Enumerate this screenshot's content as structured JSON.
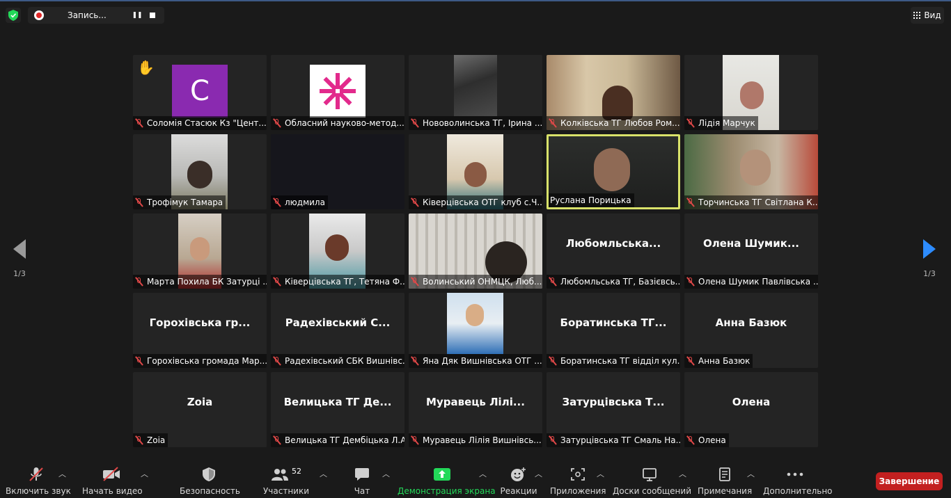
{
  "recording": {
    "label": "Запись..."
  },
  "view": {
    "label": "Вид"
  },
  "pager": {
    "left": "1/3",
    "right": "1/3"
  },
  "tiles": [
    {
      "name": "Соломія Стасюк Кз \"Цент...",
      "avatar_letter": "С",
      "kind": "avatar",
      "hand_raised": true
    },
    {
      "name": "Обласний науково-метод...",
      "kind": "logo"
    },
    {
      "name": "Нововолинська ТГ, Ірина ...",
      "kind": "video"
    },
    {
      "name": "Колківська ТГ Любов Ром...",
      "kind": "video"
    },
    {
      "name": "Лідія Марчук",
      "kind": "video"
    },
    {
      "name": "Трофімук Тамара",
      "kind": "video"
    },
    {
      "name": "людмила",
      "kind": "blank"
    },
    {
      "name": "Ківерцівська ОТГ клуб с.Ч...",
      "kind": "video"
    },
    {
      "name": "Руслана Порицька",
      "kind": "video",
      "active_speaker": true
    },
    {
      "name": "Торчинська ТГ Світлана К...",
      "kind": "video"
    },
    {
      "name": "Марта Похила БК Затурці ...",
      "kind": "video"
    },
    {
      "name": "Ківерцівська ТГ, Тетяна Ф...",
      "kind": "video"
    },
    {
      "name": "Волинський ОНМЦК, Люб...",
      "kind": "video"
    },
    {
      "name": "Любомльська ТГ, Базієвсь...",
      "big": "Любомльська...",
      "kind": "name"
    },
    {
      "name": "Олена Шумик Павлівська ...",
      "big": "Олена  Шумик...",
      "kind": "name"
    },
    {
      "name": "Горохівська громада Мар...",
      "big": "Горохівська  гр...",
      "kind": "name"
    },
    {
      "name": "Радехівський СБК Вишнівс...",
      "big": "Радехівський  С...",
      "kind": "name"
    },
    {
      "name": "Яна Дяк Вишнівська ОТГ ...",
      "kind": "video"
    },
    {
      "name": "Боратинська ТГ відділ кул...",
      "big": "Боратинська  ТГ...",
      "kind": "name"
    },
    {
      "name": "Анна Базюк",
      "big": "Анна Базюк",
      "kind": "name"
    },
    {
      "name": "Zoia",
      "big": "Zoia",
      "kind": "name"
    },
    {
      "name": "Велицька ТГ Дембіцька Л.А.",
      "big": "Велицька  ТГ  Де...",
      "kind": "name"
    },
    {
      "name": "Муравець Лілія Вишнівсь...",
      "big": "Муравець  Лілі...",
      "kind": "name"
    },
    {
      "name": "Затурцівська ТГ Смаль На...",
      "big": "Затурцівська  Т...",
      "kind": "name"
    },
    {
      "name": "Олена",
      "big": "Олена",
      "kind": "name"
    }
  ],
  "toolbar": {
    "unmute": "Включить звук",
    "start_video": "Начать видео",
    "security": "Безопасность",
    "participants": "Участники",
    "participants_count": "52",
    "chat": "Чат",
    "share": "Демонстрация экрана",
    "reactions": "Реакции",
    "apps": "Приложения",
    "whiteboards": "Доски сообщений",
    "notes": "Примечания",
    "more": "Дополнительно",
    "end": "Завершение"
  },
  "colors": {
    "share_green": "#23d959",
    "end_red": "#c32020",
    "active_border": "#d9e26a",
    "mute_red": "#e04848",
    "arrow_blue": "#2d8cff"
  }
}
